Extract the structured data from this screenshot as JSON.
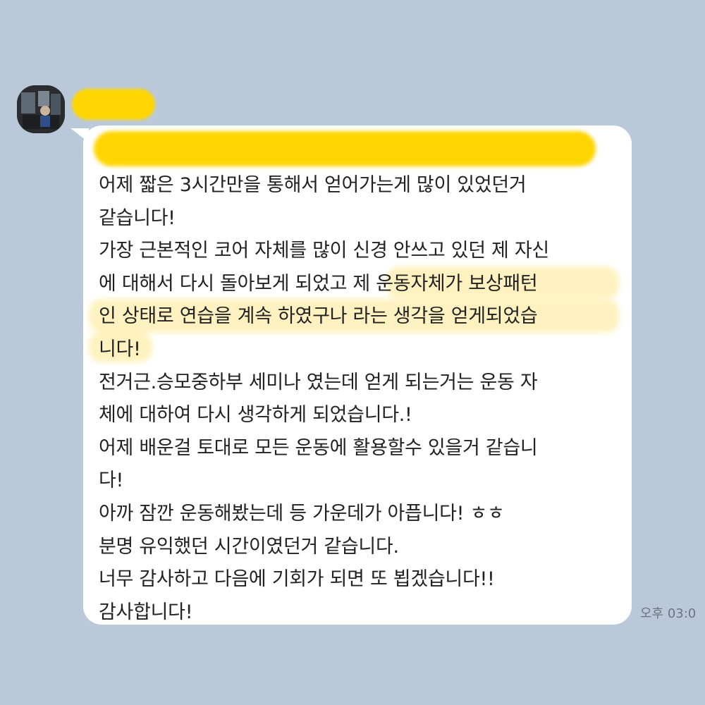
{
  "message": {
    "lines": [
      "어제 짧은 3시간만을 통해서 얻어가는게 많이 있었던거",
      "같습니다!",
      "가장 근본적인 코어 자체를 많이 신경 안쓰고 있던 제 자신",
      "에 대해서 다시 돌아보게 되었고 제 운동자체가 보상패턴",
      "인 상태로 연습을 계속 하였구나 라는 생각을 얻게되었습",
      "니다!",
      "전거근.승모중하부 세미나 였는데 얻게 되는거는 운동 자",
      "체에 대하여 다시 생각하게 되었습니다.!",
      "어제 배운걸 토대로 모든 운동에 활용할수 있을거 같습니",
      "다!",
      "아까 잠깐 운동해봤는데 등 가운데가 아픕니다! ㅎㅎ",
      "분명 유익했던 시간이였던거 같습니다.",
      "너무 감사하고 다음에 기회가 되면 또 뵙겠습니다!!",
      "감사합니다!"
    ]
  },
  "timestamp": "오후 03:0",
  "colors": {
    "background": "#bac9da",
    "bubble": "#ffffff",
    "redaction": "#ffd500",
    "highlight": "#ffe78c"
  }
}
